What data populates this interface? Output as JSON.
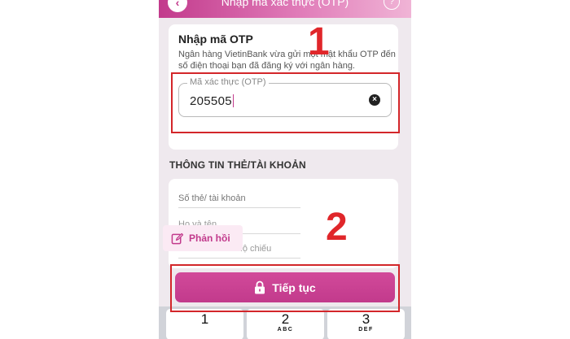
{
  "header": {
    "back_icon": "chevron-left-icon",
    "title": "Nhập mã xác thực (OTP)",
    "help_label": "?"
  },
  "otp": {
    "title": "Nhập mã OTP",
    "description": "Ngân hàng VietinBank vừa gửi một mật khẩu OTP đến số điện thoại bạn đã đăng ký với ngân hàng.",
    "field_label": "Mã xác thực (OTP)",
    "value": "205505",
    "clear_icon": "clear-circle-icon"
  },
  "account": {
    "section_title": "THÔNG TIN THẺ/TÀI KHOẢN",
    "card_number_placeholder": "Số thẻ/ tài khoản",
    "full_name_placeholder": "Họ và tên",
    "id_placeholder": "CMND/CCCD/Hộ chiếu"
  },
  "feedback": {
    "label": "Phản hồi",
    "icon": "edit-icon"
  },
  "continue_button": {
    "label": "Tiếp tục",
    "icon": "lock-icon"
  },
  "keyboard": {
    "keys": [
      {
        "number": "1",
        "letters": ""
      },
      {
        "number": "2",
        "letters": "ABC"
      },
      {
        "number": "3",
        "letters": "DEF"
      }
    ]
  },
  "annotations": {
    "step1": "1",
    "step2": "2"
  },
  "colors": {
    "brand": "#c23a8c",
    "highlight": "#d3262a"
  }
}
